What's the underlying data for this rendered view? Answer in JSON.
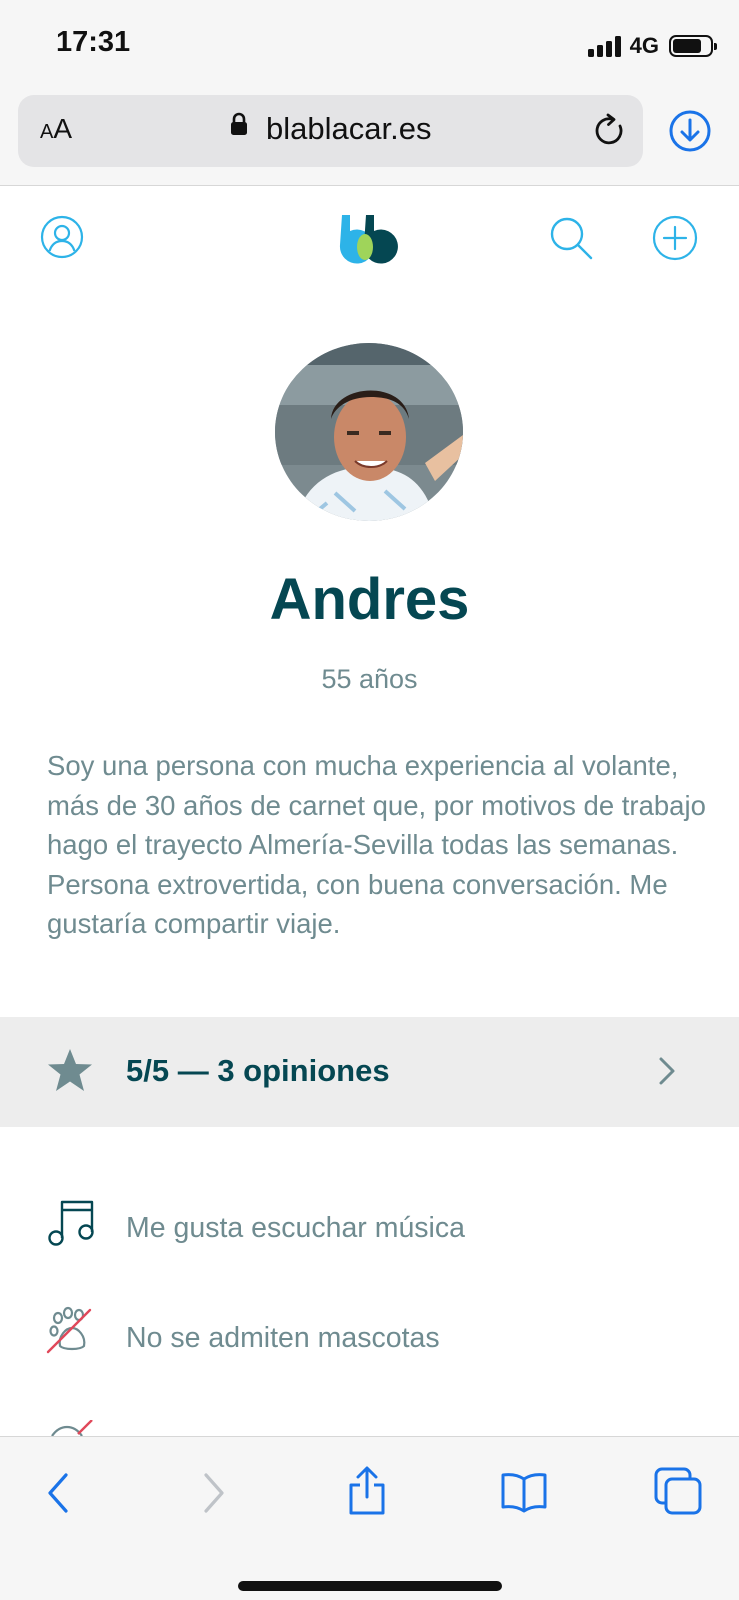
{
  "status_bar": {
    "time": "17:31",
    "network": "4G",
    "battery_level": 0.78
  },
  "browser": {
    "aa_small": "A",
    "aa_large": "A",
    "url": "blablacar.es"
  },
  "profile": {
    "name": "Andres",
    "age": "55 años",
    "bio": "Soy una persona con mucha experiencia al volante, más de 30 años de carnet que, por motivos de trabajo hago el trayecto Almería-Sevilla todas las semanas.\nPersona extrovertida, con buena conversación. Me gustaría compartir viaje."
  },
  "rating": {
    "label": "5/5 — 3 opiniones"
  },
  "preferences": [
    {
      "icon": "music-icon",
      "label": "Me gusta escuchar música"
    },
    {
      "icon": "no-pets-icon",
      "label": "No se admiten mascotas"
    }
  ],
  "colors": {
    "brand_dark": "#054752",
    "accent_blue": "#2db3e8",
    "text_muted": "#6f8b90",
    "safari_blue": "#1a73e8"
  }
}
